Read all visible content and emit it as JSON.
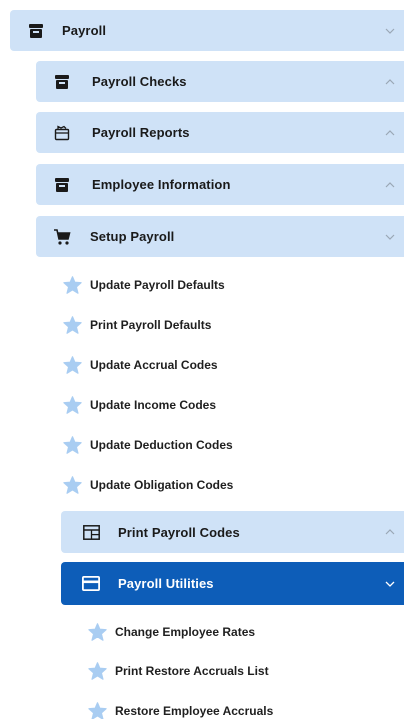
{
  "menu": {
    "payroll": {
      "label": "Payroll",
      "icon": "archive-icon"
    },
    "payroll_checks": {
      "label": "Payroll Checks",
      "icon": "archive-icon"
    },
    "payroll_reports": {
      "label": "Payroll Reports",
      "icon": "report-icon"
    },
    "employee_information": {
      "label": "Employee Information",
      "icon": "archive-icon"
    },
    "setup_payroll": {
      "label": "Setup Payroll",
      "icon": "cart-icon"
    },
    "setup_items": [
      {
        "label": "Update Payroll Defaults"
      },
      {
        "label": "Print Payroll Defaults"
      },
      {
        "label": "Update Accrual Codes"
      },
      {
        "label": "Update Income Codes"
      },
      {
        "label": "Update Deduction Codes"
      },
      {
        "label": "Update Obligation Codes"
      }
    ],
    "print_payroll_codes": {
      "label": "Print Payroll Codes",
      "icon": "table-icon"
    },
    "payroll_utilities": {
      "label": "Payroll Utilities",
      "icon": "card-icon"
    },
    "utility_items": [
      {
        "label": "Change Employee Rates"
      },
      {
        "label": "Print Restore Accruals List"
      },
      {
        "label": "Restore Employee Accruals"
      }
    ]
  },
  "colors": {
    "row_bg": "#cfe2f7",
    "active_bg": "#0d5db8",
    "star": "#a9cdf2",
    "icon": "#1a1a1a"
  }
}
